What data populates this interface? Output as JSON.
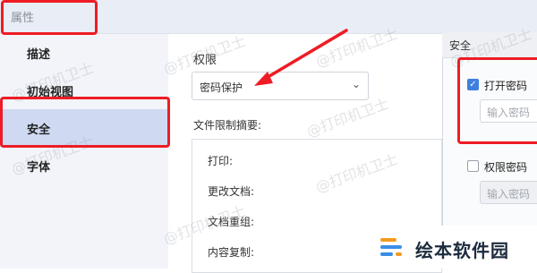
{
  "window": {
    "title": "属性"
  },
  "sidebar": {
    "items": [
      {
        "label": "描述"
      },
      {
        "label": "初始视图"
      },
      {
        "label": "安全"
      },
      {
        "label": "字体"
      }
    ],
    "active_index": 2
  },
  "main": {
    "permission_label": "权限",
    "permission_select": {
      "value": "密码保护"
    },
    "summary_label": "文件限制摘要:",
    "summary_items": [
      "打印:",
      "更改文档:",
      "文档重组:",
      "内容复制:"
    ]
  },
  "security_panel": {
    "title": "安全",
    "open_password": {
      "label": "打开密码",
      "checked": true,
      "placeholder": "输入密码"
    },
    "permission_password": {
      "label": "权限密码",
      "checked": false,
      "placeholder": "输入密码"
    }
  },
  "watermark": {
    "text": "@打印机卫士"
  },
  "logo": {
    "text": "绘本软件园"
  },
  "colors": {
    "highlight_red": "#ee1c25",
    "accent_blue": "#3f7fe0",
    "active_item": "#cfd9f2"
  },
  "icons": {
    "dropdown": "chevron-down-icon",
    "check": "checkmark-icon"
  }
}
